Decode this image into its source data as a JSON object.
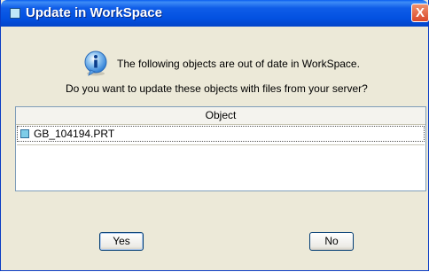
{
  "window": {
    "title": "Update in WorkSpace",
    "close_symbol": "X"
  },
  "message": {
    "line1": "The following objects are out of date in WorkSpace.",
    "line2": "Do you want to update these objects with files from your server?",
    "icon": "info-icon"
  },
  "table": {
    "column_header": "Object",
    "rows": [
      {
        "name": "GB_104194.PRT",
        "icon": "part-file-icon"
      }
    ]
  },
  "buttons": {
    "yes_label": "Yes",
    "no_label": "No"
  },
  "colors": {
    "titlebar": "#0351e0",
    "close_button": "#d9482a",
    "dialog_background": "#ece9d8",
    "info_icon": "#2f7fd6"
  }
}
